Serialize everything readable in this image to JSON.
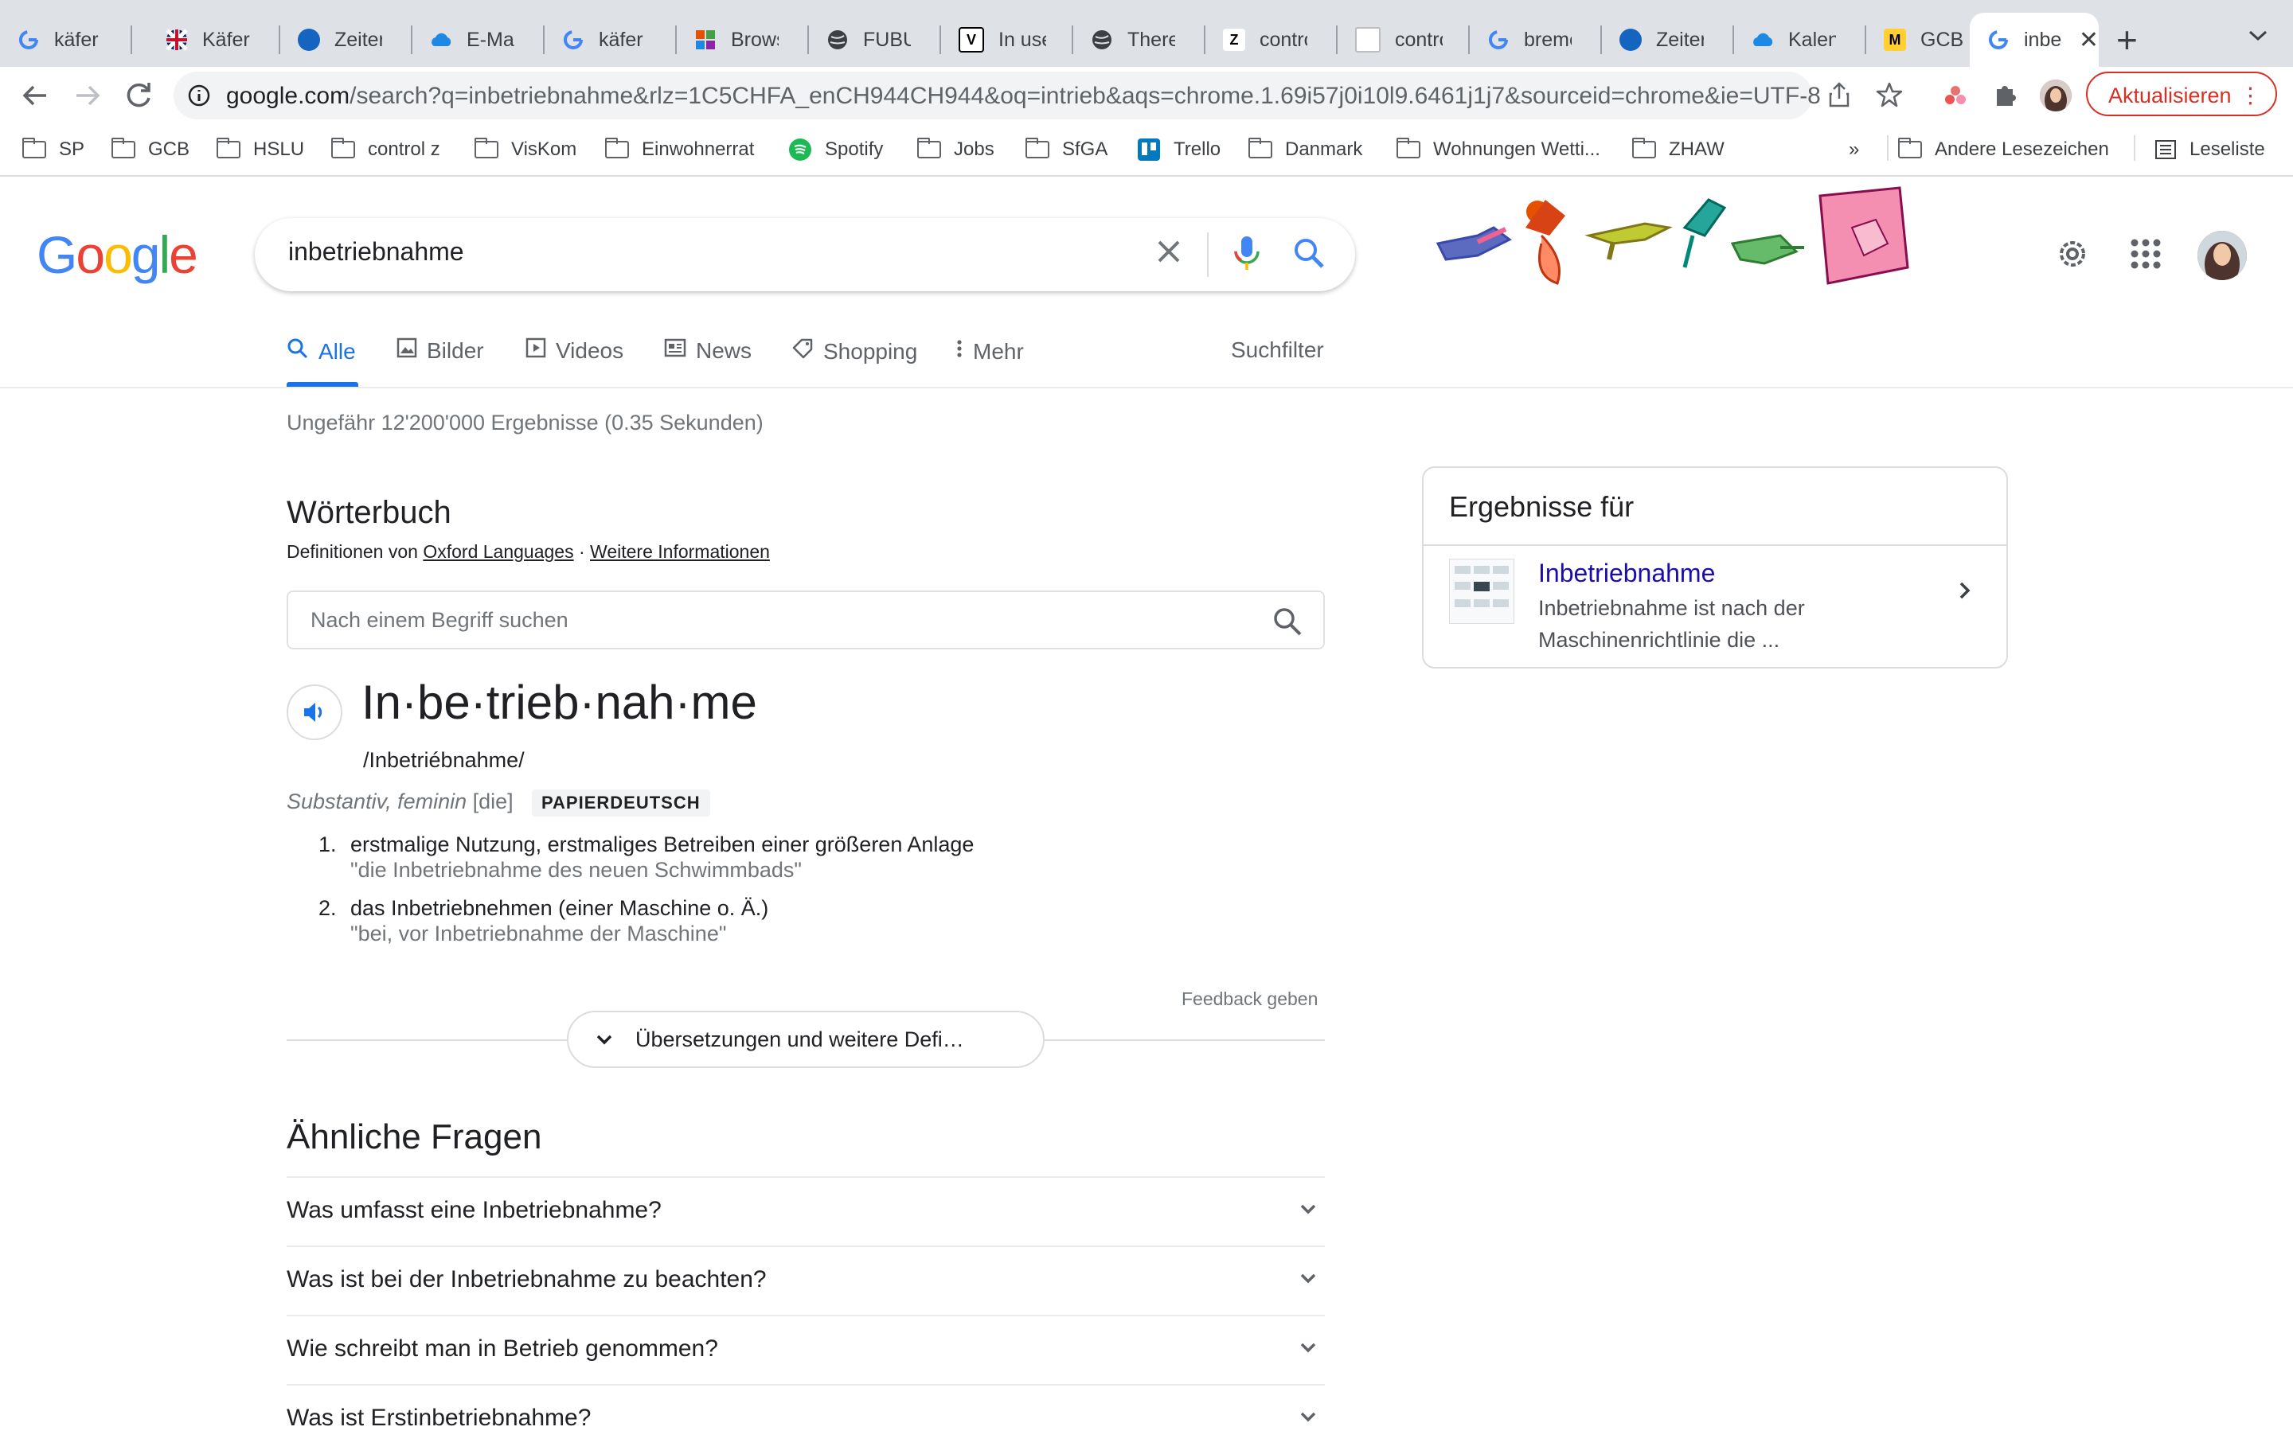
{
  "browser": {
    "tabs": [
      {
        "title": "käfer –",
        "favicon": "google-g",
        "color": "#4285f4"
      },
      {
        "title": "Käfer in",
        "favicon": "uk-flag",
        "color": "#c8102e"
      },
      {
        "title": "Zeiterfa",
        "favicon": "zeiterfassung",
        "color": "#1565c0"
      },
      {
        "title": "E-Mail",
        "favicon": "cloud-mail",
        "color": "#1e88e5"
      },
      {
        "title": "käfer –",
        "favicon": "google-g",
        "color": "#4285f4"
      },
      {
        "title": "Browse",
        "favicon": "browse-blocks",
        "color": "#e65100"
      },
      {
        "title": "FUBU –",
        "favicon": "globe",
        "color": "#3c4043"
      },
      {
        "title": "In use",
        "favicon": "v-logo",
        "color": "#000000"
      },
      {
        "title": "There A",
        "favicon": "globe",
        "color": "#3c4043"
      },
      {
        "title": "control",
        "favicon": "z-logo",
        "color": "#000000"
      },
      {
        "title": "control",
        "favicon": "doc",
        "color": "#bdbdbd"
      },
      {
        "title": "bremer",
        "favicon": "google-g",
        "color": "#4285f4"
      },
      {
        "title": "Zeiterfa",
        "favicon": "zeiterfassung",
        "color": "#1565c0"
      },
      {
        "title": "Kalende",
        "favicon": "cloud-calendar",
        "color": "#1e88e5"
      },
      {
        "title": "GCB LC",
        "favicon": "miro",
        "color": "#ffd02f"
      },
      {
        "title": "inbe",
        "favicon": "google-g",
        "color": "#4285f4",
        "active": true
      }
    ],
    "close_label": "✕",
    "new_tab": "+",
    "tab_menu": "⌄",
    "url_host": "google.com",
    "url_path": "/search?q=inbetriebnahme&rlz=1C5CHFA_enCH944CH944&oq=intrieb&aqs=chrome.1.69i57j0i10l9.6461j1j7&sourceid=chrome&ie=UTF-8",
    "update_label": "Aktualisieren",
    "bookmarks": [
      {
        "label": "SP",
        "type": "folder"
      },
      {
        "label": "GCB",
        "type": "folder"
      },
      {
        "label": "HSLU",
        "type": "folder"
      },
      {
        "label": "control z",
        "type": "folder"
      },
      {
        "label": "VisKom",
        "type": "folder"
      },
      {
        "label": "Einwohnerrat",
        "type": "folder"
      },
      {
        "label": "Spotify",
        "type": "spotify"
      },
      {
        "label": "Jobs",
        "type": "folder"
      },
      {
        "label": "SfGA",
        "type": "folder"
      },
      {
        "label": "Trello",
        "type": "trello"
      },
      {
        "label": "Danmark",
        "type": "folder"
      },
      {
        "label": "Wohnungen Wetti...",
        "type": "folder"
      },
      {
        "label": "ZHAW",
        "type": "folder"
      }
    ],
    "bookmarks_overflow": "»",
    "other_bookmarks": "Andere Lesezeichen",
    "reading_list": "Leseliste"
  },
  "google": {
    "logo": [
      "G",
      "o",
      "o",
      "g",
      "l",
      "e"
    ],
    "logo_colors": [
      "#4285f4",
      "#ea4335",
      "#fbbc05",
      "#4285f4",
      "#34a853",
      "#ea4335"
    ],
    "query": "inbetriebnahme",
    "tabs": [
      {
        "label": "Alle",
        "icon": "search-icon",
        "active": true
      },
      {
        "label": "Bilder",
        "icon": "image-icon"
      },
      {
        "label": "Videos",
        "icon": "play-icon"
      },
      {
        "label": "News",
        "icon": "news-icon"
      },
      {
        "label": "Shopping",
        "icon": "tag-icon"
      },
      {
        "label": "Mehr",
        "icon": "more-vert-icon"
      }
    ],
    "tools_label": "Suchfilter",
    "result_stats": "Ungefähr 12'200'000 Ergebnisse (0.35 Sekunden)"
  },
  "dictionary": {
    "heading": "Wörterbuch",
    "source_prefix": "Definitionen von ",
    "source_link": "Oxford Languages",
    "source_sep": " · ",
    "more_info_link": "Weitere Informationen",
    "search_placeholder": "Nach einem Begriff suchen",
    "headword": "In·be·trieb·nah·me",
    "phonetic": "/Inbetriébnahme/",
    "pos": "Substantiv, feminin",
    "article": "[die]",
    "badge": "PAPIERDEUTSCH",
    "definitions": [
      {
        "num": "1.",
        "text": "erstmalige Nutzung, erstmaliges Betreiben einer größeren Anlage",
        "example": "\"die Inbetriebnahme des neuen Schwimmbads\""
      },
      {
        "num": "2.",
        "text": "das Inbetriebnehmen (einer Maschine o. Ä.)",
        "example": "\"bei, vor Inbetriebnahme der Maschine\""
      }
    ],
    "feedback": "Feedback geben",
    "more_button": "Übersetzungen und weitere Defi…"
  },
  "related_questions": {
    "heading": "Ähnliche Fragen",
    "items": [
      "Was umfasst eine Inbetriebnahme?",
      "Was ist bei der Inbetriebnahme zu beachten?",
      "Wie schreibt man in Betrieb genommen?",
      "Was ist Erstinbetriebnahme?"
    ]
  },
  "knowledge_panel": {
    "title": "Ergebnisse für",
    "link": "Inbetriebnahme",
    "snippet": "Inbetriebnahme ist nach der Maschinenrichtlinie die ..."
  }
}
